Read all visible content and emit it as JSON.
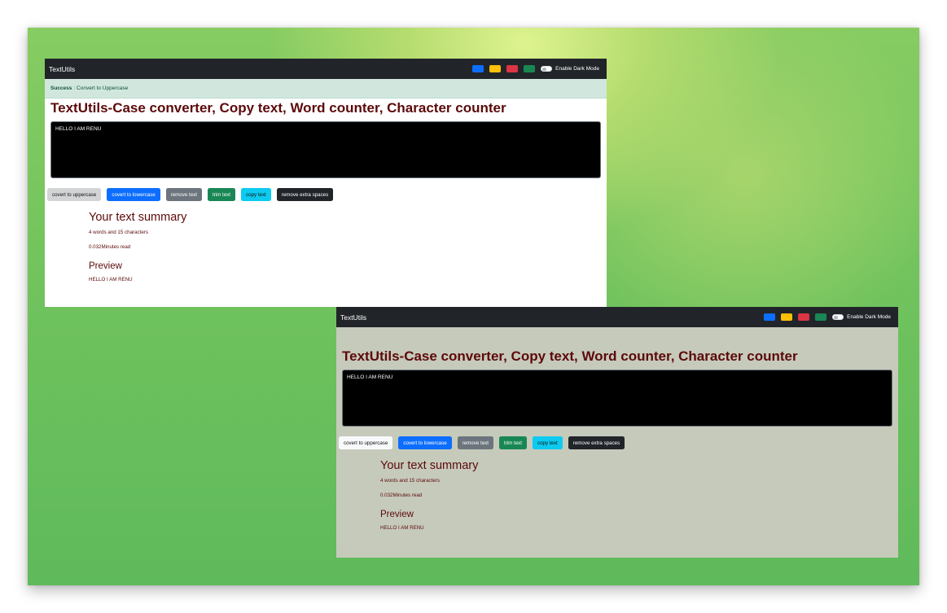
{
  "colors": {
    "navbar": "#212529",
    "heading": "#5c0a0a",
    "light_bg": "#ffffff",
    "dark_mode_bg": "#c6cabb",
    "alert_bg": "#d1e7dd",
    "swatches": [
      "#0d6efd",
      "#ffc107",
      "#dc3545",
      "#198754"
    ]
  },
  "screenshots": [
    {
      "navbar": {
        "brand": "TextUtils",
        "swatches": [
          "blue-swatch",
          "yellow-swatch",
          "red-swatch",
          "green-swatch"
        ],
        "toggle_label": "Enable Dark Mode",
        "toggle_on": false
      },
      "alert": {
        "type": "Success",
        "separator": ":",
        "message": "Convert to Uppercase"
      },
      "heading": "TextUtils-Case converter, Copy text, Word counter, Character counter",
      "textarea_value": "HELLO I AM RENU",
      "buttons": [
        "covert to uppercase",
        "covert to lowercase",
        "remove text",
        "trim text",
        "copy text",
        "remove extra spaces"
      ],
      "summary": {
        "title": "Your text summary",
        "counts": "4 words and 15 characters",
        "read_time": "0.032Minutes read",
        "preview_title": "Preview",
        "preview_text": "HELLO I AM RENU"
      }
    },
    {
      "navbar": {
        "brand": "TextUtils",
        "swatches": [
          "blue-swatch",
          "yellow-swatch",
          "red-swatch",
          "green-swatch"
        ],
        "toggle_label": "Enable Dark Mode",
        "toggle_on": false
      },
      "heading": "TextUtils-Case converter, Copy text, Word counter, Character counter",
      "textarea_value": "HELLO I AM RENU",
      "buttons": [
        "covert to uppercase",
        "covert to lowercase",
        "remove text",
        "trim text",
        "copy text",
        "remove extra spaces"
      ],
      "summary": {
        "title": "Your text summary",
        "counts": "4 words and 15 characters",
        "read_time": "0.032Minutes read",
        "preview_title": "Preview",
        "preview_text": "HELLO I AM RENU"
      }
    }
  ]
}
